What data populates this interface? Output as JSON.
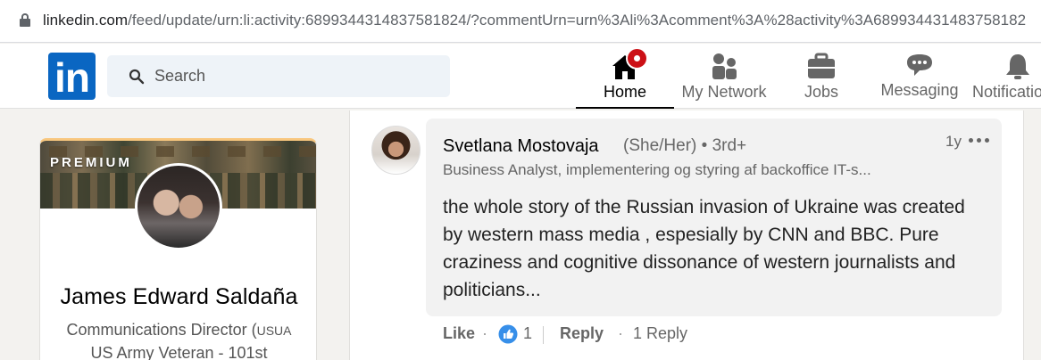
{
  "browser": {
    "url_domain": "linkedin.com",
    "url_path": "/feed/update/urn:li:activity:6899344314837581824/?commentUrn=urn%3Ali%3Acomment%3A%28activity%3A689934431483758182"
  },
  "nav": {
    "search_placeholder": "Search",
    "items": [
      {
        "label": "Home",
        "icon": "home-icon",
        "active": true
      },
      {
        "label": "My Network",
        "icon": "network-icon"
      },
      {
        "label": "Jobs",
        "icon": "briefcase-icon"
      },
      {
        "label": "Messaging",
        "icon": "messaging-icon"
      },
      {
        "label": "Notifications",
        "icon": "bell-icon"
      }
    ]
  },
  "profile": {
    "badge": "PREMIUM",
    "name": "James Edward Saldaña",
    "title_line1": "Communications Director (",
    "title_line1_small": "USUA",
    "title_line2": "US Army Veteran - 101st"
  },
  "comment": {
    "author": "Svetlana Mostovaja",
    "pronouns": "(She/Her) • 3rd+",
    "headline": "Business Analyst, implementering og styring af backoffice IT-s...",
    "time": "1y",
    "text": "the whole story of the Russian invasion of Ukraine was created by western mass media , espesially by CNN and BBC. Pure craziness and cognitive dissonance of western journalists and politicians...",
    "like_label": "Like",
    "like_count": "1",
    "reply_label": "Reply",
    "reply_count": "1 Reply",
    "separator": "·"
  },
  "colors": {
    "brand": "#0a66c2",
    "notification_badge": "#cc1016",
    "premium_accent": "#f8c77e"
  }
}
